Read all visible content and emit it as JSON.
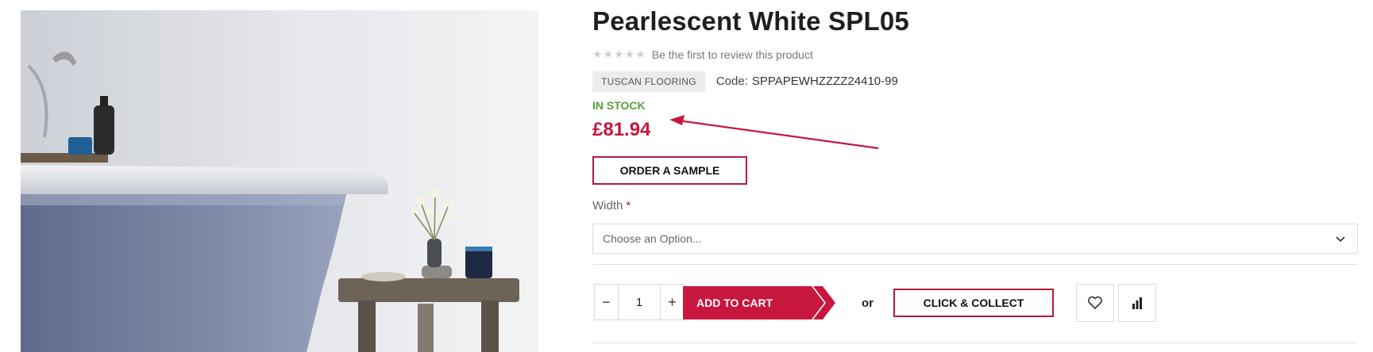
{
  "product": {
    "title": "Pearlescent White SPL05",
    "rating_stars": "★★★★★",
    "review_link": "Be the first to review this product",
    "brand": "TUSCAN FLOORING",
    "code_label": "Code:",
    "code_value": "SPPAPEWHZZZZ24410-99",
    "stock_status": "IN STOCK",
    "price": "£81.94"
  },
  "sample_button": "ORDER A SAMPLE",
  "width_option": {
    "label": "Width",
    "required_mark": "*",
    "placeholder": "Choose an Option..."
  },
  "cart": {
    "decrement": "−",
    "quantity": "1",
    "increment": "+",
    "add_to_cart": "ADD TO CART",
    "or_text": "or",
    "click_collect": "CLICK & COLLECT"
  },
  "icons": {
    "wishlist": "heart-icon",
    "compare": "bar-chart-icon",
    "select_arrow": "chevron-down-icon"
  },
  "colors": {
    "brand": "#c8173f",
    "button_border": "#b4193c",
    "in_stock": "#58a03a",
    "annotation": "#c8173f"
  }
}
